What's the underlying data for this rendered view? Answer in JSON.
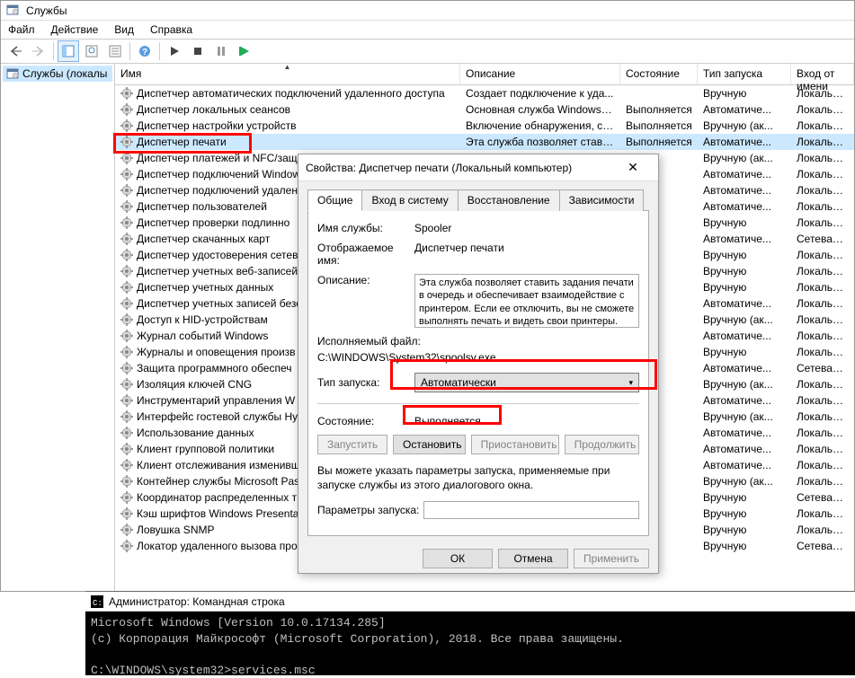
{
  "window": {
    "title": "Службы"
  },
  "menubar": [
    "Файл",
    "Действие",
    "Вид",
    "Справка"
  ],
  "sidebar": {
    "item": "Службы (локалы"
  },
  "columns": {
    "name": "Имя",
    "desc": "Описание",
    "state": "Состояние",
    "start": "Тип запуска",
    "logon": "Вход от имени"
  },
  "services": [
    {
      "name": "Диспетчер автоматических подключений удаленного доступа",
      "desc": "Создает подключение к уда...",
      "state": "",
      "start": "Вручную",
      "logon": "Локальная си..."
    },
    {
      "name": "Диспетчер локальных сеансов",
      "desc": "Основная служба Windows, ...",
      "state": "Выполняется",
      "start": "Автоматиче...",
      "logon": "Локальная си..."
    },
    {
      "name": "Диспетчер настройки устройств",
      "desc": "Включение обнаружения, ск...",
      "state": "Выполняется",
      "start": "Вручную (ак...",
      "logon": "Локальная си..."
    },
    {
      "name": "Диспетчер печати",
      "desc": "Эта служба позволяет стави...",
      "state": "Выполняется",
      "start": "Автоматиче...",
      "logon": "Локальная си..."
    },
    {
      "name": "Диспетчер платежей и NFC/защ",
      "desc": "",
      "state": "",
      "start": "Вручную (ак...",
      "logon": "Локальная си..."
    },
    {
      "name": "Диспетчер подключений Window",
      "desc": "",
      "state": "няется",
      "start": "Автоматиче...",
      "logon": "Локальная си..."
    },
    {
      "name": "Диспетчер подключений удален",
      "desc": "",
      "state": "няется",
      "start": "Автоматиче...",
      "logon": "Локальная си..."
    },
    {
      "name": "Диспетчер пользователей",
      "desc": "",
      "state": "няется",
      "start": "Автоматиче...",
      "logon": "Локальная си..."
    },
    {
      "name": "Диспетчер проверки подлинно",
      "desc": "",
      "state": "",
      "start": "Вручную",
      "logon": "Локальная си..."
    },
    {
      "name": "Диспетчер скачанных карт",
      "desc": "",
      "state": "",
      "start": "Автоматиче...",
      "logon": "Сетевая служ..."
    },
    {
      "name": "Диспетчер удостоверения сетев",
      "desc": "",
      "state": "",
      "start": "Вручную",
      "logon": "Локальная си..."
    },
    {
      "name": "Диспетчер учетных веб-записей",
      "desc": "",
      "state": "няется",
      "start": "Вручную",
      "logon": "Локальная си..."
    },
    {
      "name": "Диспетчер учетных данных",
      "desc": "",
      "state": "няется",
      "start": "Вручную",
      "logon": "Локальная си..."
    },
    {
      "name": "Диспетчер учетных записей безо",
      "desc": "",
      "state": "няется",
      "start": "Автоматиче...",
      "logon": "Локальная си..."
    },
    {
      "name": "Доступ к HID-устройствам",
      "desc": "",
      "state": "няется",
      "start": "Вручную (ак...",
      "logon": "Локальная си..."
    },
    {
      "name": "Журнал событий Windows",
      "desc": "",
      "state": "няется",
      "start": "Автоматиче...",
      "logon": "Локальная сл..."
    },
    {
      "name": "Журналы и оповещения произв",
      "desc": "",
      "state": "",
      "start": "Вручную",
      "logon": "Локальная сл..."
    },
    {
      "name": "Защита программного обеспеч",
      "desc": "",
      "state": "",
      "start": "Автоматиче...",
      "logon": "Сетевая служ..."
    },
    {
      "name": "Изоляция ключей CNG",
      "desc": "",
      "state": "няется",
      "start": "Вручную (ак...",
      "logon": "Локальная си..."
    },
    {
      "name": "Инструментарий управления W",
      "desc": "",
      "state": "няется",
      "start": "Автоматиче...",
      "logon": "Локальная си..."
    },
    {
      "name": "Интерфейс гостевой службы Hy",
      "desc": "",
      "state": "",
      "start": "Вручную (ак...",
      "logon": "Локальная си..."
    },
    {
      "name": "Использование данных",
      "desc": "",
      "state": "няется",
      "start": "Автоматиче...",
      "logon": "Локальная сл..."
    },
    {
      "name": "Клиент групповой политики",
      "desc": "",
      "state": "няется",
      "start": "Автоматиче...",
      "logon": "Локальная си..."
    },
    {
      "name": "Клиент отслеживания изменивш",
      "desc": "",
      "state": "няется",
      "start": "Автоматиче...",
      "logon": "Локальная си..."
    },
    {
      "name": "Контейнер службы Microsoft Pas",
      "desc": "",
      "state": "",
      "start": "Вручную (ак...",
      "logon": "Локальная сл..."
    },
    {
      "name": "Координатор распределенных т",
      "desc": "",
      "state": "",
      "start": "Вручную",
      "logon": "Сетевая служ..."
    },
    {
      "name": "Кэш шрифтов Windows Presenta",
      "desc": "",
      "state": "няется",
      "start": "Вручную",
      "logon": "Локальная сл..."
    },
    {
      "name": "Ловушка SNMP",
      "desc": "",
      "state": "",
      "start": "Вручную",
      "logon": "Локальная сл..."
    },
    {
      "name": "Локатор удаленного вызова проц...",
      "desc": "",
      "state": "",
      "start": "Вручную",
      "logon": "Сетевая служ..."
    }
  ],
  "dialog": {
    "title": "Свойства: Диспетчер печати (Локальный компьютер)",
    "tabs": [
      "Общие",
      "Вход в систему",
      "Восстановление",
      "Зависимости"
    ],
    "general": {
      "svc_name_label": "Имя службы:",
      "svc_name_value": "Spooler",
      "display_name_label": "Отображаемое имя:",
      "display_name_value": "Диспетчер печати",
      "desc_label": "Описание:",
      "desc_value": "Эта служба позволяет ставить задания печати в очередь и обеспечивает взаимодействие с принтером. Если ее отключить, вы не сможете выполнять печать и видеть свои принтеры.",
      "exe_label": "Исполняемый файл:",
      "exe_value": "C:\\WINDOWS\\System32\\spoolsv.exe",
      "start_type_label": "Тип запуска:",
      "start_type_value": "Автоматически",
      "state_label": "Состояние:",
      "state_value": "Выполняется",
      "btn_start": "Запустить",
      "btn_stop": "Остановить",
      "btn_pause": "Приостановить",
      "btn_resume": "Продолжить",
      "hint": "Вы можете указать параметры запуска, применяемые при запуске службы из этого диалогового окна.",
      "params_label": "Параметры запуска:"
    },
    "footer": {
      "ok": "ОК",
      "cancel": "Отмена",
      "apply": "Применить"
    }
  },
  "console": {
    "title": "Администратор: Командная строка",
    "lines": [
      "Microsoft Windows [Version 10.0.17134.285]",
      "(c) Корпорация Майкрософт (Microsoft Corporation), 2018. Все права защищены.",
      "",
      "C:\\WINDOWS\\system32>services.msc"
    ]
  }
}
